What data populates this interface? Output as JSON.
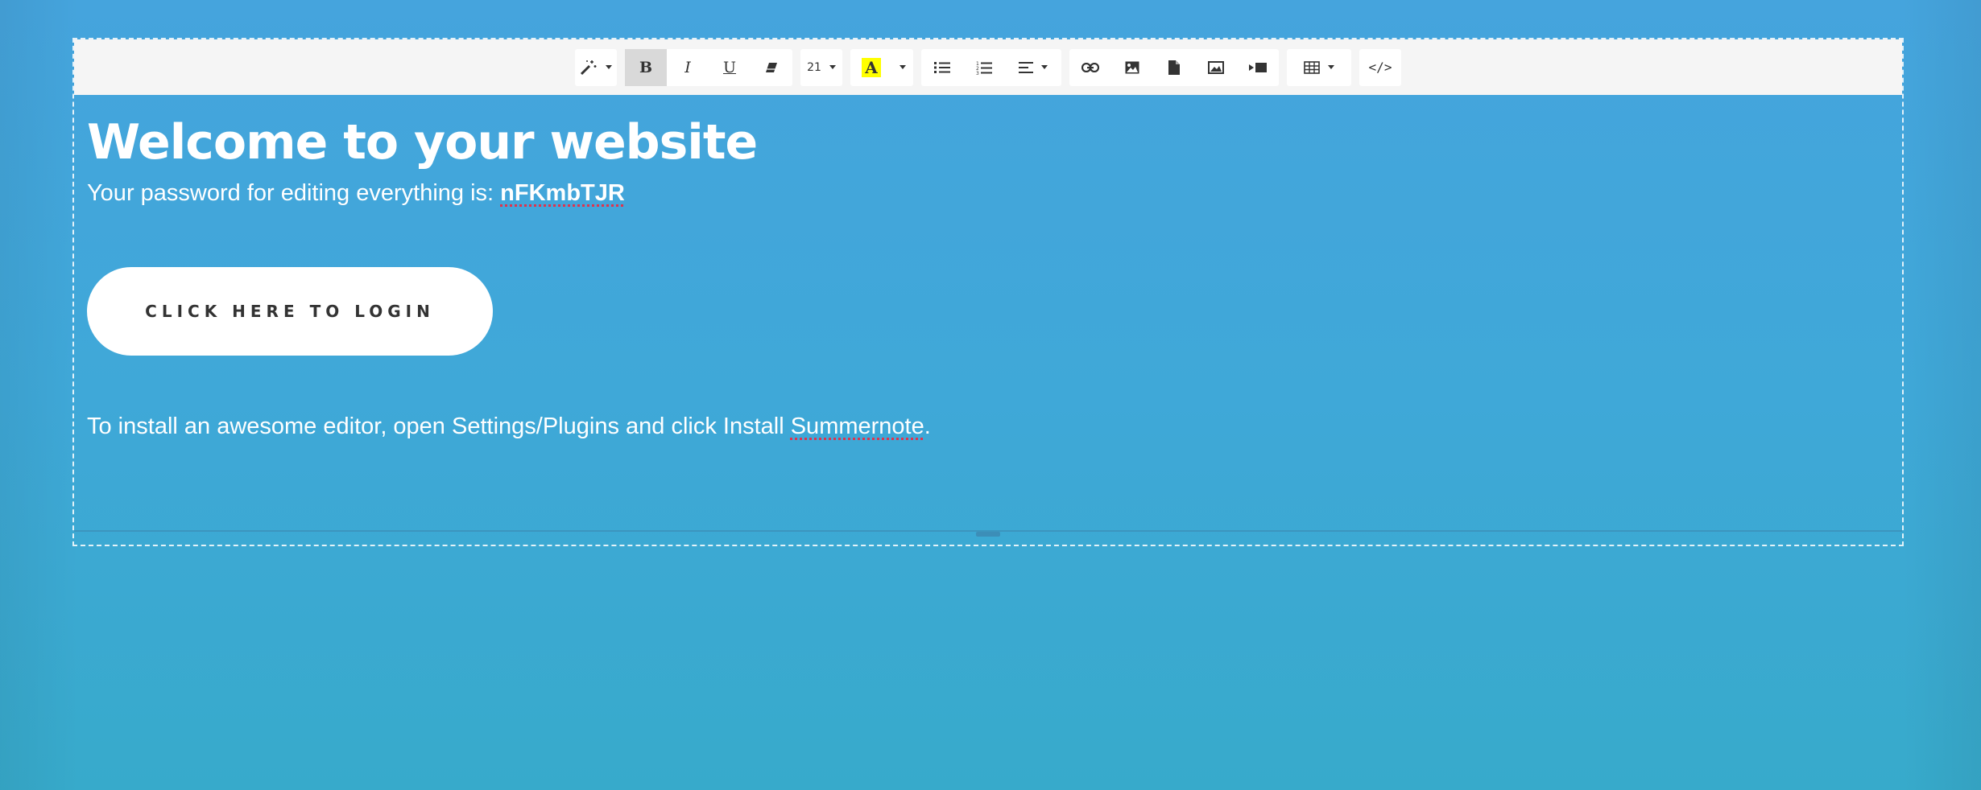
{
  "toolbar": {
    "style": {
      "icon": "magic-wand-icon"
    },
    "bold": {
      "label": "B"
    },
    "italic": {
      "label": "I"
    },
    "underline": {
      "label": "U"
    },
    "clear": {
      "icon": "eraser-icon"
    },
    "font_size": {
      "value": "21"
    },
    "color": {
      "label": "A",
      "highlight": "#ffff00"
    },
    "lists": {
      "unordered_icon": "unordered-list-icon",
      "ordered_icon": "ordered-list-icon"
    },
    "align": {
      "icon": "align-icon"
    },
    "insert": {
      "link_icon": "link-icon",
      "image_icon": "image-icon",
      "file_icon": "file-icon",
      "gallery_icon": "gallery-icon",
      "video_icon": "video-icon"
    },
    "table": {
      "icon": "table-icon"
    },
    "code": {
      "label": "</>"
    }
  },
  "content": {
    "headline": "Welcome to your website",
    "password_prefix": "Your password for editing everything is: ",
    "password": "nFKmbTJR",
    "login_button": "CLICK HERE TO LOGIN",
    "install_prefix": "To install an awesome editor, open Settings/Plugins and click Install ",
    "install_link": "Summernote",
    "install_suffix": "."
  },
  "colors": {
    "background": "#42a5d9",
    "toolbar_bg": "#f5f5f5",
    "text": "#ffffff",
    "button_text": "#333333"
  }
}
